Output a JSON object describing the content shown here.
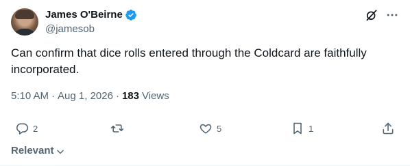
{
  "author": {
    "name": "James O'Beirne",
    "handle": "@jamesob",
    "verified_color": "#1d9bf0"
  },
  "tweet": {
    "text": "Can confirm that dice rolls entered through the Coldcard are faithfully incorporated.",
    "time": "5:10 AM",
    "date": "Aug 1, 2026",
    "views_count": "183",
    "views_label": "Views"
  },
  "actions": {
    "replies": "2",
    "reposts": "",
    "likes": "5",
    "bookmarks": "1"
  },
  "sort": {
    "label": "Relevant"
  },
  "icons": {
    "top": [
      "grok-icon",
      "more-icon"
    ],
    "actions": [
      "reply-icon",
      "repost-icon",
      "like-icon",
      "bookmark-icon",
      "share-icon"
    ]
  },
  "colors": {
    "text_primary": "#0f1419",
    "text_secondary": "#536471",
    "accent": "#1d9bf0"
  }
}
